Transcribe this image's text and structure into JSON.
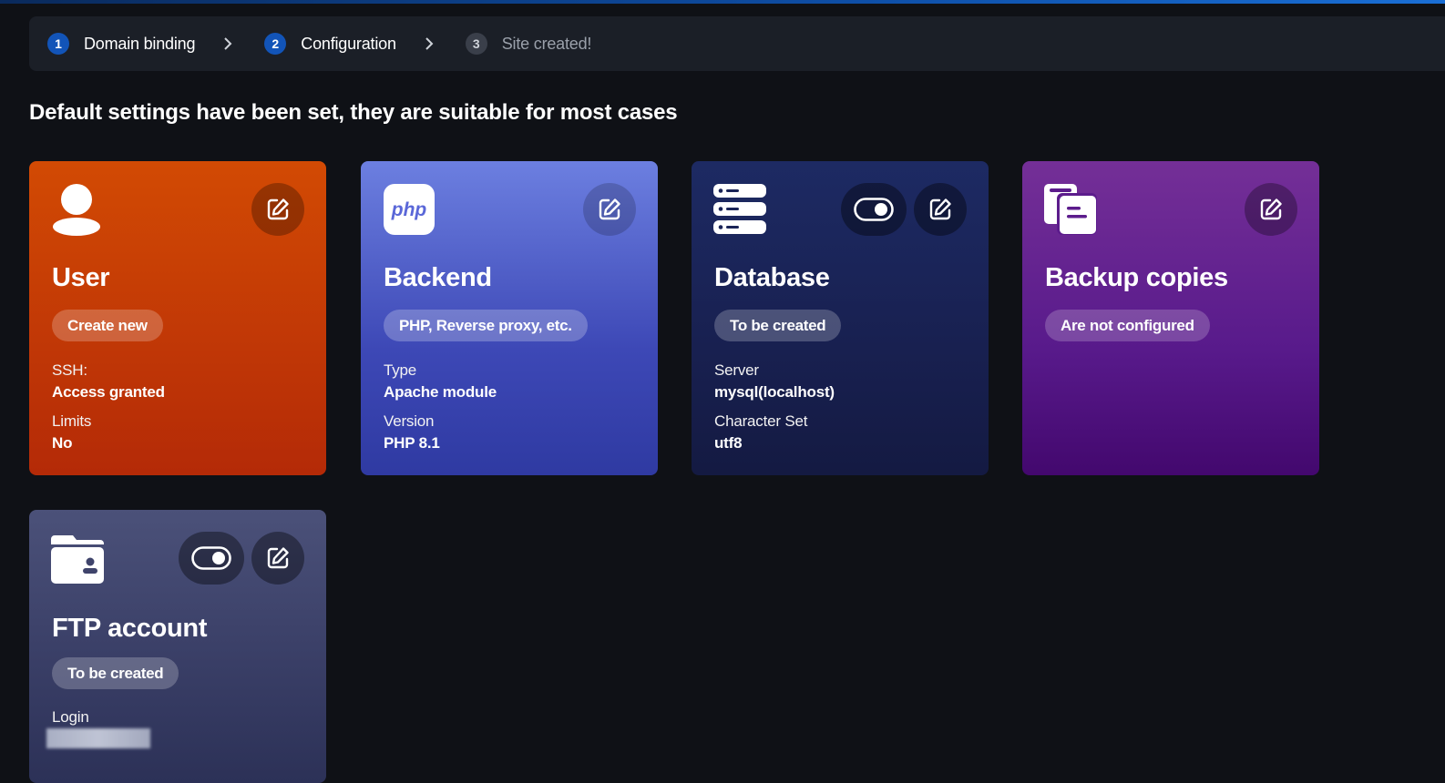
{
  "stepper": {
    "steps": [
      {
        "num": "1",
        "label": "Domain binding",
        "state": "done"
      },
      {
        "num": "2",
        "label": "Configuration",
        "state": "active"
      },
      {
        "num": "3",
        "label": "Site created!",
        "state": "inactive"
      }
    ]
  },
  "heading": "Default settings have been set, they are suitable for most cases",
  "cards": {
    "user": {
      "icon": "user-icon",
      "title": "User",
      "badge": "Create new",
      "props": [
        {
          "label": "SSH:",
          "value": "Access granted"
        },
        {
          "label": "Limits",
          "value": "No"
        }
      ]
    },
    "backend": {
      "icon": "php-icon",
      "icon_text": "php",
      "title": "Backend",
      "badge": "PHP, Reverse proxy, etc.",
      "props": [
        {
          "label": "Type",
          "value": "Apache module"
        },
        {
          "label": "Version",
          "value": "PHP 8.1"
        }
      ]
    },
    "database": {
      "icon": "database-server-icon",
      "title": "Database",
      "badge": "To be created",
      "toggle_on": true,
      "props": [
        {
          "label": "Server",
          "value": "mysql(localhost)"
        },
        {
          "label": "Character Set",
          "value": "utf8"
        }
      ]
    },
    "backup": {
      "icon": "documents-copy-icon",
      "title": "Backup copies",
      "badge": "Are not configured"
    },
    "ftp": {
      "icon": "folder-user-icon",
      "title": "FTP account",
      "badge": "To be created",
      "toggle_on": true,
      "props": [
        {
          "label": "Login",
          "value": ""
        }
      ]
    }
  },
  "colors": {
    "accent": "#1254b8",
    "user_card": "#c93a05",
    "backend_card": "#5563cf",
    "database_card": "#1a2457",
    "backup_card": "#5c1c8c",
    "ftp_card": "#3f446b"
  }
}
